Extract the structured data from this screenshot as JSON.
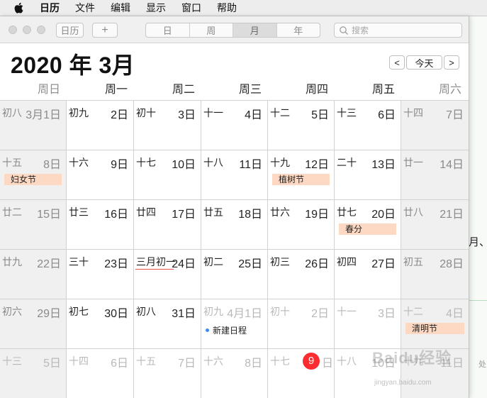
{
  "menubar": {
    "items": [
      "日历",
      "文件",
      "编辑",
      "显示",
      "窗口",
      "帮助"
    ]
  },
  "background_doc": {
    "fragment_1": "月、",
    "fragment_2": "处"
  },
  "toolbar": {
    "calendars_label": "日历",
    "add_label": "+",
    "views": [
      "日",
      "周",
      "月",
      "年"
    ],
    "selected_view": "月",
    "search_placeholder": "搜索"
  },
  "header": {
    "title": "2020 年 3月",
    "prev_label": "<",
    "today_label": "今天",
    "next_label": ">"
  },
  "weekdays": [
    "周日",
    "周一",
    "周二",
    "周三",
    "周四",
    "周五",
    "周六"
  ],
  "weeks": [
    [
      {
        "lunar": "初八",
        "day": "3月1日"
      },
      {
        "lunar": "初九",
        "day": "2日"
      },
      {
        "lunar": "初十",
        "day": "3日"
      },
      {
        "lunar": "十一",
        "day": "4日"
      },
      {
        "lunar": "十二",
        "day": "5日"
      },
      {
        "lunar": "十三",
        "day": "6日"
      },
      {
        "lunar": "十四",
        "day": "7日"
      }
    ],
    [
      {
        "lunar": "十五",
        "day": "8日",
        "event": "妇女节"
      },
      {
        "lunar": "十六",
        "day": "9日"
      },
      {
        "lunar": "十七",
        "day": "10日"
      },
      {
        "lunar": "十八",
        "day": "11日"
      },
      {
        "lunar": "十九",
        "day": "12日",
        "event": "植树节"
      },
      {
        "lunar": "二十",
        "day": "13日"
      },
      {
        "lunar": "廿一",
        "day": "14日"
      }
    ],
    [
      {
        "lunar": "廿二",
        "day": "15日"
      },
      {
        "lunar": "廿三",
        "day": "16日"
      },
      {
        "lunar": "廿四",
        "day": "17日"
      },
      {
        "lunar": "廿五",
        "day": "18日"
      },
      {
        "lunar": "廿六",
        "day": "19日"
      },
      {
        "lunar": "廿七",
        "day": "20日",
        "event": "春分"
      },
      {
        "lunar": "廿八",
        "day": "21日"
      }
    ],
    [
      {
        "lunar": "廿九",
        "day": "22日"
      },
      {
        "lunar": "三十",
        "day": "23日"
      },
      {
        "lunar": "三月初一",
        "day": "24日"
      },
      {
        "lunar": "初二",
        "day": "25日"
      },
      {
        "lunar": "初三",
        "day": "26日"
      },
      {
        "lunar": "初四",
        "day": "27日"
      },
      {
        "lunar": "初五",
        "day": "28日"
      }
    ],
    [
      {
        "lunar": "初六",
        "day": "29日"
      },
      {
        "lunar": "初七",
        "day": "30日"
      },
      {
        "lunar": "初八",
        "day": "31日"
      },
      {
        "lunar": "初九",
        "day": "4月1日",
        "plain_event": "新建日程"
      },
      {
        "lunar": "初十",
        "day": "2日"
      },
      {
        "lunar": "十一",
        "day": "3日"
      },
      {
        "lunar": "十二",
        "day": "4日",
        "event": "清明节"
      }
    ],
    [
      {
        "lunar": "十三",
        "day": "5日"
      },
      {
        "lunar": "十四",
        "day": "6日"
      },
      {
        "lunar": "十五",
        "day": "7日"
      },
      {
        "lunar": "十六",
        "day": "8日"
      },
      {
        "lunar": "十七",
        "day": "9",
        "day_suffix": "日"
      },
      {
        "lunar": "十八",
        "day": "10日"
      },
      {
        "lunar": "十九",
        "day": "11日"
      }
    ]
  ],
  "watermark": {
    "text": "Baidu经验",
    "sub": "jingyan.baidu.com"
  },
  "colors": {
    "holiday_bg": "#fdd9c4",
    "today_red": "#fb2d30",
    "event_dot": "#3a8ee8"
  }
}
